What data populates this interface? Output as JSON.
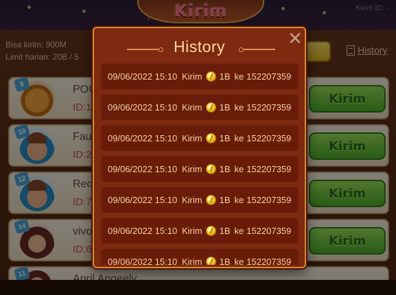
{
  "background": {
    "title": "Kirim",
    "top_right_text": "Kirim ID: -",
    "bisa_kirim": "Bisa kirim: 900M",
    "limit_harian": "Limit harian: 20B / 5",
    "history_link": "History",
    "send_label": "Kirim",
    "friends": [
      {
        "level": "8",
        "name": "POC",
        "id": "ID:1",
        "avatar": "tiger"
      },
      {
        "level": "10",
        "name": "Fauz",
        "id": "ID:2",
        "avatar": "man"
      },
      {
        "level": "12",
        "name": "Red",
        "id": "ID:7",
        "avatar": "man"
      },
      {
        "level": "14",
        "name": "vivo",
        "id": "ID:6",
        "avatar": "woman"
      },
      {
        "level": "11",
        "name": "April Angeely",
        "id": "",
        "avatar": "woman"
      }
    ]
  },
  "modal": {
    "title": "History",
    "close_icon": "close-icon",
    "rows": [
      {
        "date": "09/06/2022 15:10",
        "action": "Kirim",
        "amount": "1B",
        "ke": "ke",
        "uid": "152207359"
      },
      {
        "date": "09/06/2022 15:10",
        "action": "Kirim",
        "amount": "1B",
        "ke": "ke",
        "uid": "152207359"
      },
      {
        "date": "09/06/2022 15:10",
        "action": "Kirim",
        "amount": "1B",
        "ke": "ke",
        "uid": "152207359"
      },
      {
        "date": "09/06/2022 15:10",
        "action": "Kirim",
        "amount": "1B",
        "ke": "ke",
        "uid": "152207359"
      },
      {
        "date": "09/06/2022 15:10",
        "action": "Kirim",
        "amount": "1B",
        "ke": "ke",
        "uid": "152207359"
      },
      {
        "date": "09/06/2022 15:10",
        "action": "Kirim",
        "amount": "1B",
        "ke": "ke",
        "uid": "152207359"
      },
      {
        "date": "09/06/2022 15:10",
        "action": "Kirim",
        "amount": "1B",
        "ke": "ke",
        "uid": "152207359"
      }
    ]
  },
  "colors": {
    "modal_bg": "#7e2a10",
    "row_bg": "#6a1c0a",
    "text": "#f6d2a0",
    "border": "#d88a3a"
  }
}
